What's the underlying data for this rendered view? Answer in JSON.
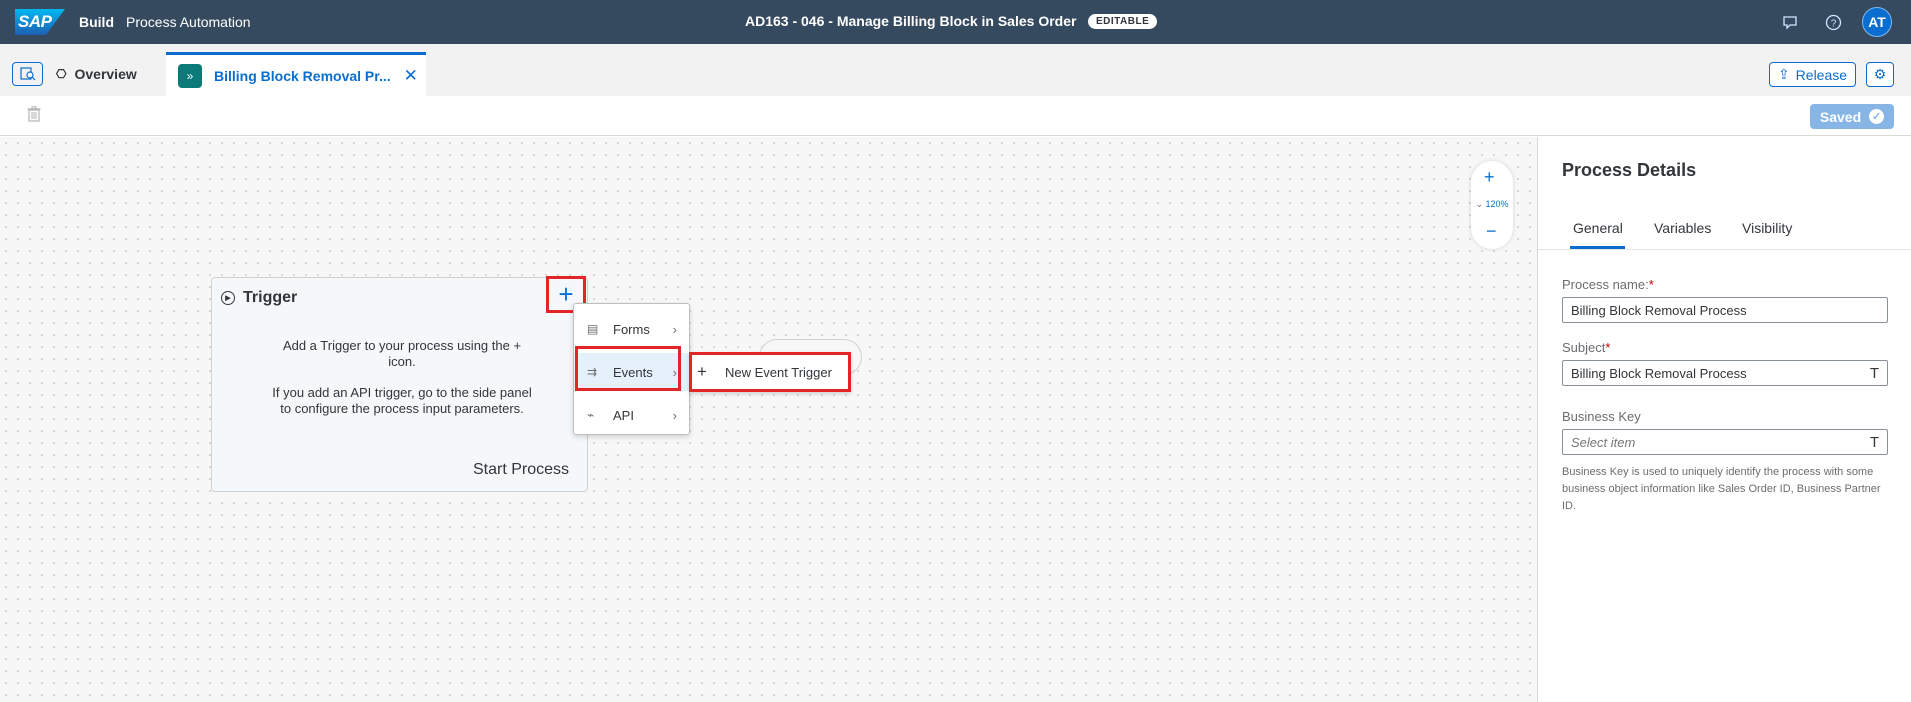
{
  "shell": {
    "logo": "SAP",
    "build": "Build",
    "product": "Process Automation",
    "title": "AD163 - 046 - Manage Billing Block in Sales Order",
    "badge": "EDITABLE",
    "avatar": "AT",
    "icons": [
      "feedback-icon",
      "help-icon"
    ]
  },
  "tabs": {
    "overview": "Overview",
    "active": "Billing Block Removal Pr...",
    "release": "Release"
  },
  "toolbar": {
    "saved": "Saved"
  },
  "canvas": {
    "zoom_level": "120%",
    "trigger": {
      "title": "Trigger",
      "text1": "Add a Trigger to your process using the + icon.",
      "text2": "If you add an API trigger, go to the side panel to configure the process input parameters.",
      "start": "Start Process"
    },
    "menu": [
      {
        "label": "Forms",
        "icon": "form-icon"
      },
      {
        "label": "Events",
        "icon": "event-icon"
      },
      {
        "label": "API",
        "icon": "api-icon"
      }
    ],
    "submenu": {
      "label": "New Event Trigger",
      "icon": "add-icon"
    }
  },
  "panel": {
    "title": "Process Details",
    "tabs": [
      "General",
      "Variables",
      "Visibility"
    ],
    "fields": {
      "process_name_label": "Process name:",
      "process_name_value": "Billing Block Removal Process",
      "subject_label": "Subject",
      "subject_value": "Billing Block Removal Process",
      "business_key_label": "Business Key",
      "business_key_placeholder": "Select item",
      "business_key_help": "Business Key is used to uniquely identify the process with some business object information like Sales Order ID, Business Partner ID."
    }
  },
  "colors": {
    "shell_bg": "#354a5f",
    "accent": "#0a6ed1",
    "highlight": "#e32528"
  }
}
